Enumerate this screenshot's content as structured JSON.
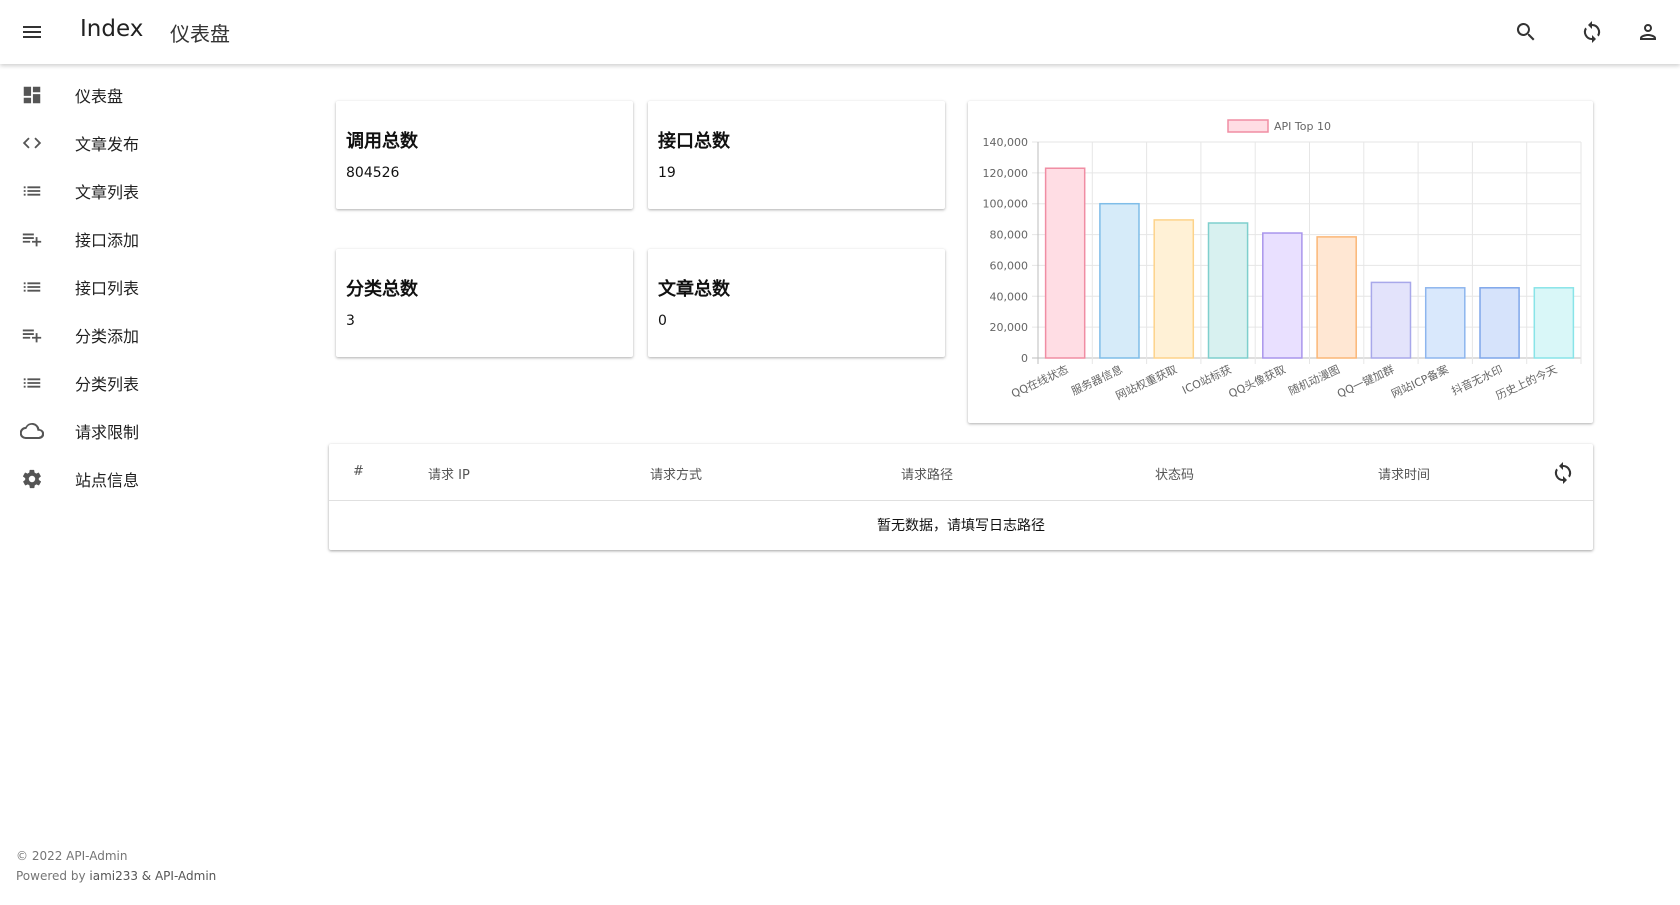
{
  "appbar": {
    "app_title": "Index",
    "page_title": "仪表盘"
  },
  "sidebar": {
    "items": [
      {
        "label": "仪表盘",
        "icon": "dashboard-icon"
      },
      {
        "label": "文章发布",
        "icon": "code-icon"
      },
      {
        "label": "文章列表",
        "icon": "list-icon"
      },
      {
        "label": "接口添加",
        "icon": "playlist-add-icon"
      },
      {
        "label": "接口列表",
        "icon": "list-icon"
      },
      {
        "label": "分类添加",
        "icon": "playlist-add-icon"
      },
      {
        "label": "分类列表",
        "icon": "list-icon"
      },
      {
        "label": "请求限制",
        "icon": "cloud-icon"
      },
      {
        "label": "站点信息",
        "icon": "gear-icon"
      }
    ]
  },
  "stats": {
    "calls_label": "调用总数",
    "calls_value": "804526",
    "apis_label": "接口总数",
    "apis_value": "19",
    "categories_label": "分类总数",
    "categories_value": "3",
    "articles_label": "文章总数",
    "articles_value": "0"
  },
  "chart_data": {
    "type": "bar",
    "legend": "API Top 10",
    "legend_position": "top-center",
    "categories": [
      "QQ在线状态",
      "服务器信息",
      "网站权重获取",
      "ICO站标获",
      "QQ头像获取",
      "随机动漫图",
      "QQ一键加群",
      "网站ICP备案",
      "抖音无水印",
      "历史上的今天"
    ],
    "values": [
      123000,
      100000,
      89500,
      87500,
      81000,
      78500,
      49000,
      45500,
      45500,
      45500
    ],
    "ylim": [
      0,
      140000
    ],
    "yticks": [
      "0",
      "20,000",
      "40,000",
      "60,000",
      "80,000",
      "100,000",
      "120,000",
      "140,000"
    ],
    "grid": true,
    "colors": [
      {
        "fill": "#ffdde4",
        "stroke": "#f08da3"
      },
      {
        "fill": "#d6ebf9",
        "stroke": "#7fbde8"
      },
      {
        "fill": "#fff1d6",
        "stroke": "#fdd38a"
      },
      {
        "fill": "#d8f1f0",
        "stroke": "#7ecfcd"
      },
      {
        "fill": "#e9e0ff",
        "stroke": "#a995ec"
      },
      {
        "fill": "#ffe7d3",
        "stroke": "#fbb776"
      },
      {
        "fill": "#e3e3fb",
        "stroke": "#a8a8ea"
      },
      {
        "fill": "#d9e8fc",
        "stroke": "#8db5ee"
      },
      {
        "fill": "#d6e3fb",
        "stroke": "#7ea6ea"
      },
      {
        "fill": "#d9f7f8",
        "stroke": "#88e4e8"
      }
    ]
  },
  "table": {
    "headers": [
      "#",
      "请求 IP",
      "请求方式",
      "请求路径",
      "状态码",
      "请求时间"
    ],
    "empty_text": "暂无数据，请填写日志路径"
  },
  "footer": {
    "copyright": "© 2022 API-Admin",
    "powered_prefix": "Powered by ",
    "powered_authors": "iami233 & API-Admin"
  }
}
